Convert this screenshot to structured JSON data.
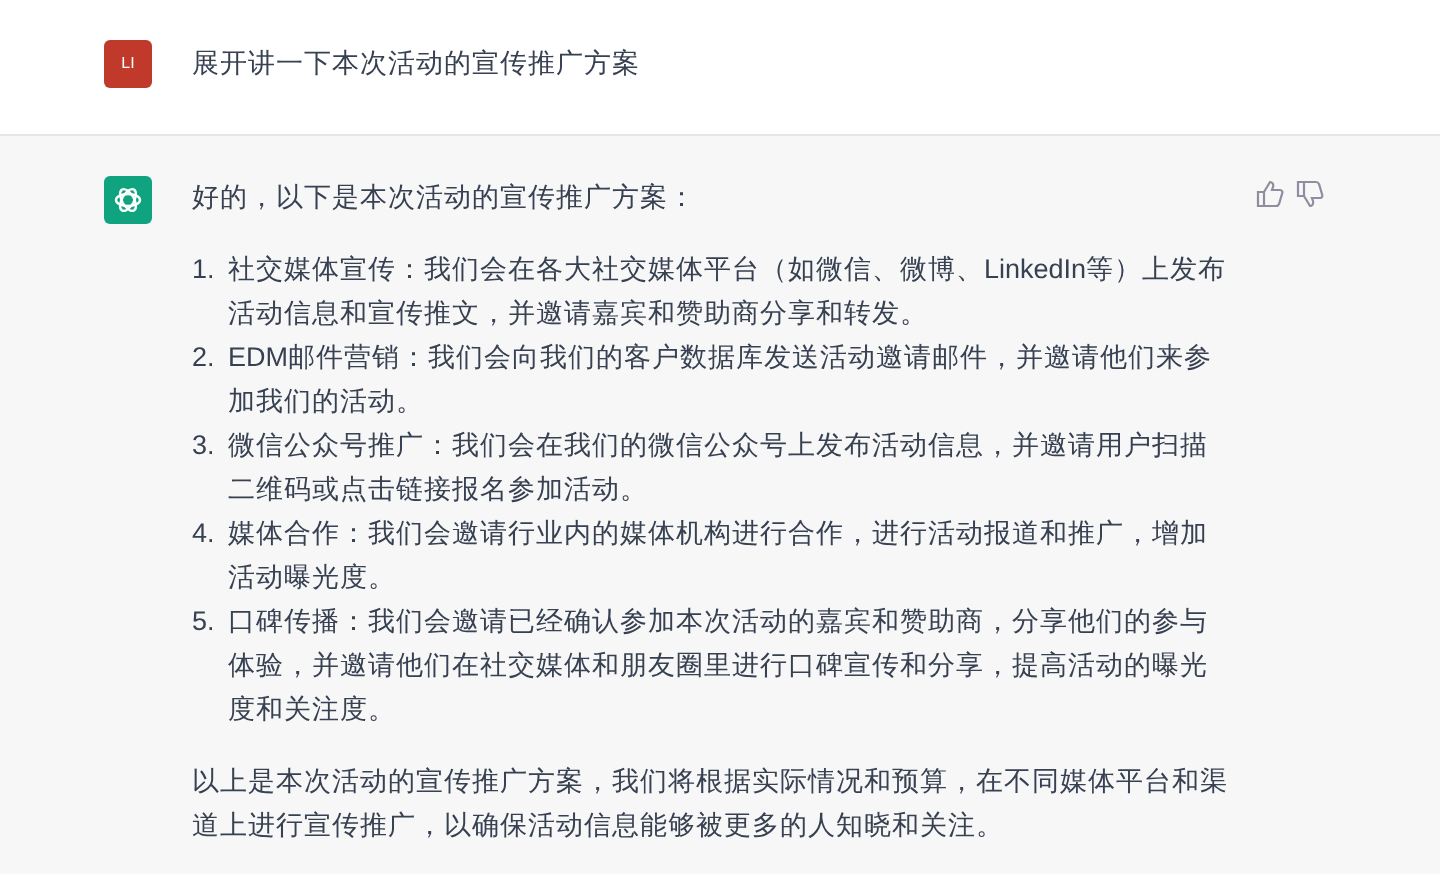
{
  "user_message": {
    "avatar": "LI",
    "text": "展开讲一下本次活动的宣传推广方案"
  },
  "assistant_message": {
    "intro": "好的，以下是本次活动的宣传推广方案：",
    "items": [
      {
        "number": "1.",
        "text": "社交媒体宣传：我们会在各大社交媒体平台（如微信、微博、LinkedIn等）上发布活动信息和宣传推文，并邀请嘉宾和赞助商分享和转发。"
      },
      {
        "number": "2.",
        "text": "EDM邮件营销：我们会向我们的客户数据库发送活动邀请邮件，并邀请他们来参加我们的活动。"
      },
      {
        "number": "3.",
        "text": "微信公众号推广：我们会在我们的微信公众号上发布活动信息，并邀请用户扫描二维码或点击链接报名参加活动。"
      },
      {
        "number": "4.",
        "text": "媒体合作：我们会邀请行业内的媒体机构进行合作，进行活动报道和推广，增加活动曝光度。"
      },
      {
        "number": "5.",
        "text": "口碑传播：我们会邀请已经确认参加本次活动的嘉宾和赞助商，分享他们的参与体验，并邀请他们在社交媒体和朋友圈里进行口碑宣传和分享，提高活动的曝光度和关注度。"
      }
    ],
    "closing": "以上是本次活动的宣传推广方案，我们将根据实际情况和预算，在不同媒体平台和渠道上进行宣传推广，以确保活动信息能够被更多的人知晓和关注。"
  }
}
